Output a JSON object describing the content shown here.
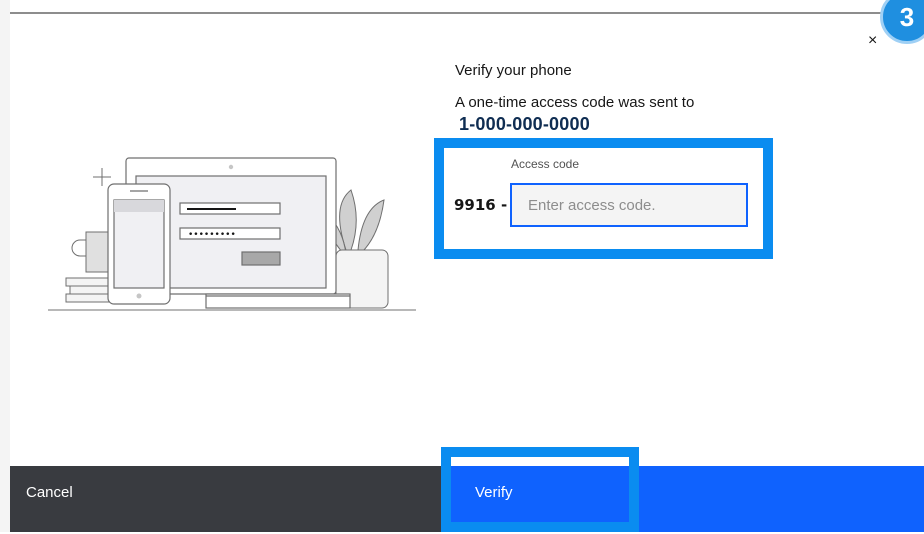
{
  "step_badge": "3",
  "close_glyph": "×",
  "dialog": {
    "title": "Verify your phone",
    "description": "A one-time access code was sent to",
    "phone_number": "1-000-000-0000"
  },
  "access_code": {
    "label": "Access code",
    "prefix": "9916 -",
    "value": "",
    "placeholder": "Enter access code."
  },
  "footer": {
    "cancel_label": "Cancel",
    "verify_label": "Verify"
  },
  "colors": {
    "primary": "#0f62fe",
    "secondary": "#393b40",
    "highlight": "#0a8cf0"
  },
  "icons": {
    "close": "close-icon",
    "illustration": "laptop-phone-login-illustration"
  }
}
